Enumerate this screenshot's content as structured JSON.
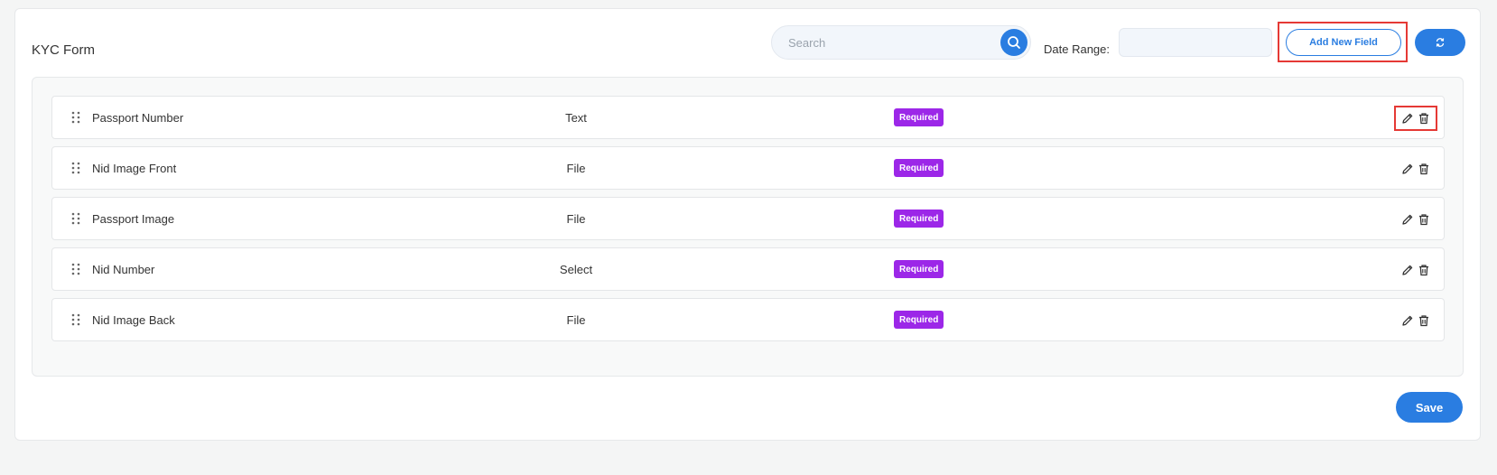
{
  "header": {
    "title": "KYC Form",
    "search_placeholder": "Search",
    "date_range_label": "Date Range:",
    "add_button_label": "Add New Field"
  },
  "fields": [
    {
      "name": "Passport Number",
      "type": "Text",
      "status": "Required"
    },
    {
      "name": "Nid Image Front",
      "type": "File",
      "status": "Required"
    },
    {
      "name": "Passport Image",
      "type": "File",
      "status": "Required"
    },
    {
      "name": "Nid Number",
      "type": "Select",
      "status": "Required"
    },
    {
      "name": "Nid Image Back",
      "type": "File",
      "status": "Required"
    }
  ],
  "footer": {
    "save_label": "Save"
  },
  "icons": {
    "search": "search-icon",
    "refresh": "refresh-icon",
    "drag": "drag-handle-icon",
    "edit": "pencil-icon",
    "delete": "trash-icon"
  },
  "colors": {
    "primary": "#2a7de1",
    "badge": "#9c27e8",
    "highlight": "#e53935"
  }
}
